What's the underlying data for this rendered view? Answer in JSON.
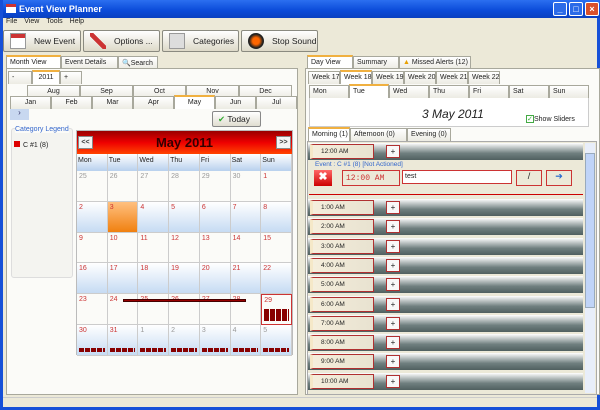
{
  "window": {
    "title": "Event View Planner"
  },
  "menu": [
    "File",
    "View",
    "Tools",
    "Help"
  ],
  "toolbar": {
    "new_event": "New Event",
    "options": "Options ...",
    "categories": "Categories",
    "stop_sound": "Stop Sound"
  },
  "left": {
    "tabs": [
      "Month View",
      "Event Details",
      "Search"
    ],
    "year": {
      "prev": "-",
      "value": "2011",
      "next": "+"
    },
    "months_row1": [
      "Aug",
      "Sep",
      "Oct",
      "Nov",
      "Dec"
    ],
    "months_row2": [
      "Jan",
      "Feb",
      "Mar",
      "Apr",
      "May",
      "Jun",
      "Jul"
    ],
    "expand": "›",
    "today_label": "Today",
    "legend_title": "Category Legend",
    "legend_items": [
      {
        "label": "C #1 (8)",
        "color": "#dd0000"
      }
    ],
    "calendar": {
      "title": "May 2011",
      "prev": "<<",
      "next": ">>",
      "weekdays": [
        "Mon",
        "Tue",
        "Wed",
        "Thu",
        "Fri",
        "Sat",
        "Sun"
      ],
      "weeks": [
        [
          "25",
          "26",
          "27",
          "28",
          "29",
          "30",
          "1"
        ],
        [
          "2",
          "3",
          "4",
          "5",
          "6",
          "7",
          "8"
        ],
        [
          "9",
          "10",
          "11",
          "12",
          "13",
          "14",
          "15"
        ],
        [
          "16",
          "17",
          "18",
          "19",
          "20",
          "21",
          "22"
        ],
        [
          "23",
          "24",
          "25",
          "26",
          "27",
          "28",
          "29"
        ],
        [
          "30",
          "31",
          "1",
          "2",
          "3",
          "4",
          "5"
        ]
      ]
    }
  },
  "right": {
    "tabs": [
      "Day View",
      "Summary",
      "Missed Alerts (12)"
    ],
    "weeks": [
      "Week 17",
      "Week 18",
      "Week 19",
      "Week 20",
      "Week 21",
      "Week 22"
    ],
    "days": [
      "Mon",
      "Tue",
      "Wed",
      "Thu",
      "Fri",
      "Sat",
      "Sun"
    ],
    "date": "3 May 2011",
    "show_sliders": "Show Sliders",
    "periods": [
      "Morning (1)",
      "Afternoon (0)",
      "Evening (0)"
    ],
    "event": {
      "header": "Event : C #1 (8)  [Not Actioned]",
      "time": "12:00  AM",
      "text": "test"
    },
    "slots": [
      "12:00 AM",
      "1:00 AM",
      "2:00 AM",
      "3:00 AM",
      "4:00 AM",
      "5:00 AM",
      "6:00 AM",
      "7:00 AM",
      "8:00 AM",
      "9:00 AM",
      "10:00 AM"
    ],
    "add": "+"
  }
}
